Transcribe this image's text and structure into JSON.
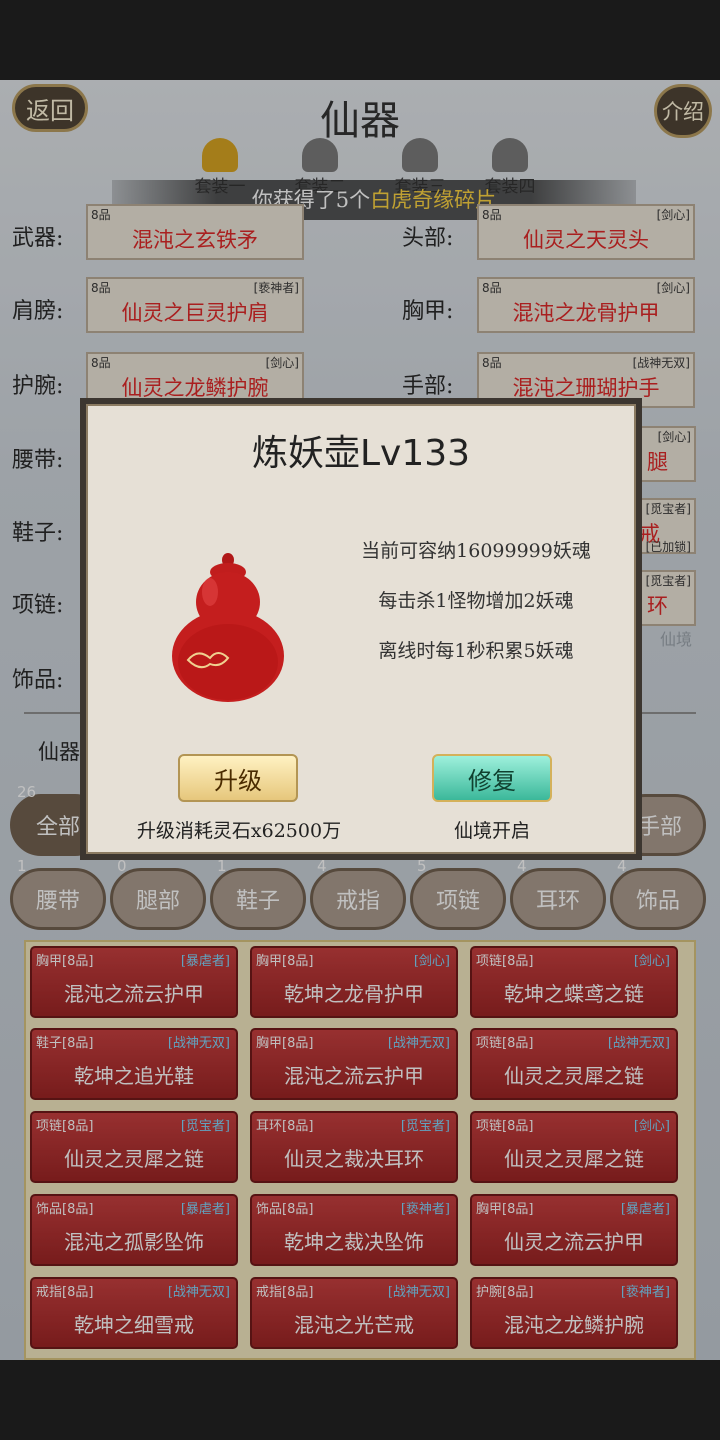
{
  "header": {
    "back_label": "返回",
    "title": "仙器",
    "intro_label": "介绍"
  },
  "suits": [
    {
      "label": "套装一",
      "color": "#d9a21a"
    },
    {
      "label": "套装二",
      "color": "#777777"
    },
    {
      "label": "套装三",
      "color": "#777777"
    },
    {
      "label": "套装四",
      "color": "#777777"
    }
  ],
  "toast": {
    "prefix": "你获得了5个",
    "highlight": "白虎奇缘碎片"
  },
  "slots": {
    "weapon": {
      "label": "武器:",
      "grade": "8品",
      "tag": "",
      "name": "混沌之玄铁矛"
    },
    "head": {
      "label": "头部:",
      "grade": "8品",
      "tag": "[剑心]",
      "name": "仙灵之天灵头"
    },
    "shoulder": {
      "label": "肩膀:",
      "grade": "8品",
      "tag": "[亵神者]",
      "name": "仙灵之巨灵护肩"
    },
    "chest": {
      "label": "胸甲:",
      "grade": "8品",
      "tag": "[剑心]",
      "name": "混沌之龙骨护甲"
    },
    "wrist": {
      "label": "护腕:",
      "grade": "8品",
      "tag": "[剑心]",
      "name": "仙灵之龙鳞护腕"
    },
    "hand": {
      "label": "手部:",
      "grade": "8品",
      "tag": "[战神无双]",
      "name": "混沌之珊瑚护手"
    },
    "belt": {
      "label": "腰带:"
    },
    "shoes": {
      "label": "鞋子:"
    },
    "necklace": {
      "label": "项链:"
    },
    "ornament": {
      "label": "饰品:"
    }
  },
  "partial": {
    "leg_tag": "[剑心]",
    "leg_name": "腿",
    "ring_tag": "[觅宝者]",
    "ring_name": "戒",
    "ring_lock": "[已加锁]",
    "ear_tag": "[觅宝者]",
    "ear_name": "环",
    "bg_text": "仙境"
  },
  "artifact_label": "仙器",
  "filters": [
    {
      "count": "26",
      "label": "全部"
    },
    {
      "count": "",
      "label": "手部"
    },
    {
      "count": "1",
      "label": "腰带"
    },
    {
      "count": "0",
      "label": "腿部"
    },
    {
      "count": "1",
      "label": "鞋子"
    },
    {
      "count": "4",
      "label": "戒指"
    },
    {
      "count": "5",
      "label": "项链"
    },
    {
      "count": "4",
      "label": "耳环"
    },
    {
      "count": "4",
      "label": "饰品"
    }
  ],
  "items": [
    {
      "type": "胸甲[8品]",
      "tag": "[暴虐者]",
      "name": "混沌之流云护甲"
    },
    {
      "type": "胸甲[8品]",
      "tag": "[剑心]",
      "name": "乾坤之龙骨护甲"
    },
    {
      "type": "项链[8品]",
      "tag": "[剑心]",
      "name": "乾坤之蝶鸢之链"
    },
    {
      "type": "鞋子[8品]",
      "tag": "[战神无双]",
      "name": "乾坤之追光鞋"
    },
    {
      "type": "胸甲[8品]",
      "tag": "[战神无双]",
      "name": "混沌之流云护甲"
    },
    {
      "type": "项链[8品]",
      "tag": "[战神无双]",
      "name": "仙灵之灵犀之链"
    },
    {
      "type": "项链[8品]",
      "tag": "[觅宝者]",
      "name": "仙灵之灵犀之链"
    },
    {
      "type": "耳环[8品]",
      "tag": "[觅宝者]",
      "name": "仙灵之裁决耳环"
    },
    {
      "type": "项链[8品]",
      "tag": "[剑心]",
      "name": "仙灵之灵犀之链"
    },
    {
      "type": "饰品[8品]",
      "tag": "[暴虐者]",
      "name": "混沌之孤影坠饰"
    },
    {
      "type": "饰品[8品]",
      "tag": "[亵神者]",
      "name": "乾坤之裁决坠饰"
    },
    {
      "type": "胸甲[8品]",
      "tag": "[暴虐者]",
      "name": "仙灵之流云护甲"
    },
    {
      "type": "戒指[8品]",
      "tag": "[战神无双]",
      "name": "乾坤之细雪戒"
    },
    {
      "type": "戒指[8品]",
      "tag": "[战神无双]",
      "name": "混沌之光芒戒"
    },
    {
      "type": "护腕[8品]",
      "tag": "[亵神者]",
      "name": "混沌之龙鳞护腕"
    }
  ],
  "modal": {
    "title": "炼妖壶Lv133",
    "line1": "当前可容纳16099999妖魂",
    "line2": "每击杀1怪物增加2妖魂",
    "line3": "离线时每1秒积累5妖魂",
    "upgrade_label": "升级",
    "repair_label": "修复",
    "upgrade_cost": "升级消耗灵石x62500万",
    "repair_caption": "仙境开启"
  }
}
